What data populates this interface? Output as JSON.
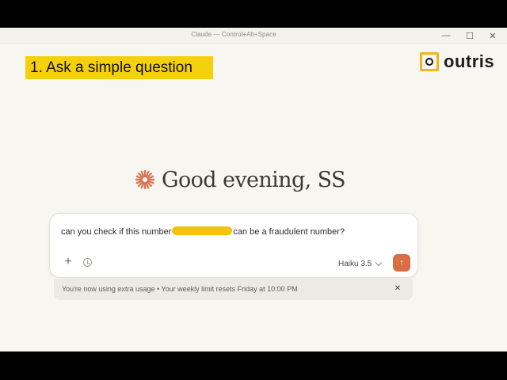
{
  "window": {
    "title": "Claude — Control+Alt+Space",
    "controls": {
      "minimize": "—",
      "maximize": "☐",
      "close": "✕"
    }
  },
  "callout": {
    "text": "1. Ask a simple question"
  },
  "logo": {
    "text": "outris",
    "mark_icon": "outris-logo-icon",
    "colors": {
      "mark": "#f0b51d",
      "text": "#1d1d1d"
    }
  },
  "greeting": {
    "text": "Good evening, SS",
    "icon": "claude-spark-icon",
    "icon_color": "#d97757"
  },
  "composer": {
    "prompt_before": "can you check if this number",
    "prompt_after": "can be a fraudulent number?",
    "redaction_color": "#f1c40f",
    "attach_icon": "+",
    "model": "Haiku 3.5",
    "send_icon": "↑",
    "send_color": "#d86e44"
  },
  "notice": {
    "text": "You're now using extra usage • Your weekly limit resets Friday at 10:00 PM",
    "close_icon": "✕"
  }
}
